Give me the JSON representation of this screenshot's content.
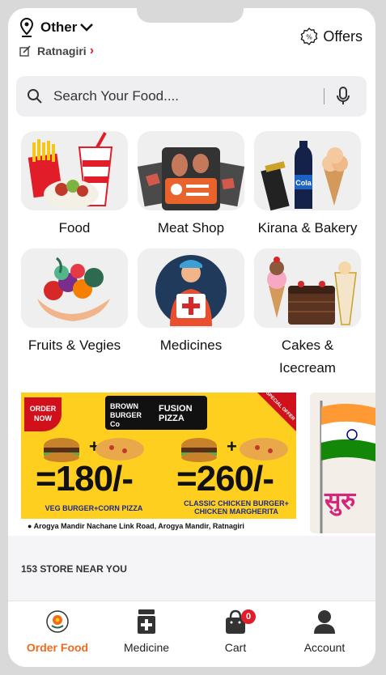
{
  "header": {
    "location_label": "Other",
    "city": "Ratnagiri",
    "offers_label": "Offers"
  },
  "search": {
    "placeholder": "Search Your Food...."
  },
  "categories": [
    {
      "label": "Food"
    },
    {
      "label": "Meat Shop"
    },
    {
      "label": "Kirana & Bakery"
    },
    {
      "label": "Fruits & Vegies"
    },
    {
      "label": "Medicines"
    },
    {
      "label": "Cakes &\nIcecream"
    }
  ],
  "banner": {
    "order_now": "ORDER NOW",
    "brand_left": "BROWN BURGER Co",
    "brand_right": "FUSION PIZZA",
    "special_offer": "SPECIAL OFFER",
    "price1": "=180/-",
    "price2": "=260/-",
    "caption1": "VEG BURGER+CORN PIZZA",
    "caption2": "CLASSIC CHICKEN BURGER+ CHICKEN MARGHERITA",
    "address": "Arogya Mandir Nachane Link Road, Arogya Mandir, Ratnagiri",
    "banner2_text": "सुरु"
  },
  "stores": {
    "label": "153 STORE NEAR YOU"
  },
  "tabs": [
    {
      "label": "Order Food"
    },
    {
      "label": "Medicine"
    },
    {
      "label": "Cart",
      "badge": "0"
    },
    {
      "label": "Account"
    }
  ],
  "colors": {
    "accent": "#f26a1b",
    "badge": "#e11d2a",
    "banner_yellow": "#ffcf1f"
  }
}
